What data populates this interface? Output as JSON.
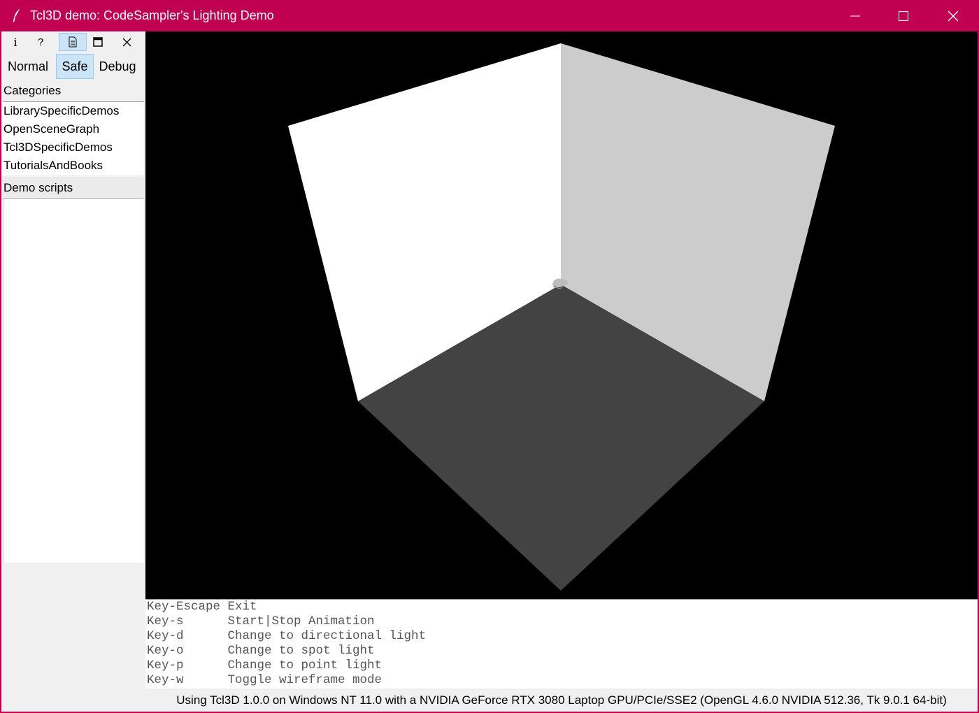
{
  "window": {
    "title": "Tcl3D demo: CodeSampler's Lighting Demo",
    "titlebar_color": "#c20052"
  },
  "toolbar": {
    "icons": [
      "info-icon",
      "help-icon",
      "document-icon",
      "maximize-view-icon",
      "close-icon"
    ],
    "info_label": "i",
    "help_label": "?",
    "active_icon": "document-icon"
  },
  "modes": {
    "items": [
      "Normal",
      "Safe",
      "Debug"
    ],
    "selected": "Safe"
  },
  "categories": {
    "label": "Categories",
    "items": [
      "LibrarySpecificDemos",
      "OpenSceneGraph",
      "Tcl3DSpecificDemos",
      "TutorialsAndBooks"
    ]
  },
  "demo_scripts": {
    "label": "Demo scripts",
    "items": []
  },
  "viewport": {
    "background": "#000000",
    "left_wall_color": "#ffffff",
    "right_wall_color": "#cccccc",
    "floor_color": "#434343"
  },
  "console": {
    "lines": [
      "Key-Escape Exit",
      "Key-s      Start|Stop Animation",
      "Key-d      Change to directional light",
      "Key-o      Change to spot light",
      "Key-p      Change to point light",
      "Key-w      Toggle wireframe mode"
    ]
  },
  "status": {
    "text": "Using Tcl3D 1.0.0 on Windows NT 11.0 with a NVIDIA GeForce RTX 3080 Laptop GPU/PCIe/SSE2 (OpenGL 4.6.0 NVIDIA 512.36, Tk 9.0.1 64-bit)"
  }
}
